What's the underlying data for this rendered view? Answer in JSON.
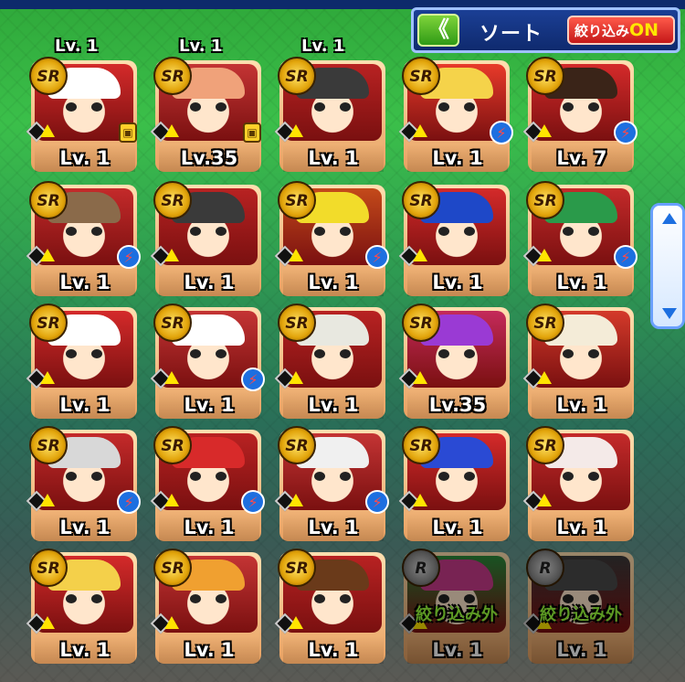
{
  "toolbar": {
    "back_icon": "double-chevron-left-icon",
    "back_label": "《",
    "sort_label": "ソート",
    "filter_label": "絞り込み",
    "filter_state": "ON"
  },
  "partial_row": [
    "Lv. 1",
    "Lv. 1",
    "Lv. 1"
  ],
  "cards": [
    {
      "rarity": "SR",
      "level": "Lv. 1",
      "badge": "lock",
      "hair": "#ffffff",
      "bg": "#d42a2a"
    },
    {
      "rarity": "SR",
      "level": "Lv.35",
      "badge": "lock",
      "hair": "#f0a27a",
      "bg": "#c43434"
    },
    {
      "rarity": "SR",
      "level": "Lv. 1",
      "badge": "none",
      "hair": "#3a3a3a",
      "bg": "#b82222"
    },
    {
      "rarity": "SR",
      "level": "Lv. 1",
      "badge": "bolt",
      "hair": "#f5d34a",
      "bg": "#e83a2a"
    },
    {
      "rarity": "SR",
      "level": "Lv. 7",
      "badge": "bolt",
      "hair": "#3a2418",
      "bg": "#d42a2a"
    },
    {
      "rarity": "SR",
      "level": "Lv. 1",
      "badge": "bolt",
      "hair": "#8a6a4a",
      "bg": "#c42a2a"
    },
    {
      "rarity": "SR",
      "level": "Lv. 1",
      "badge": "none",
      "hair": "#3a3a3a",
      "bg": "#b82222"
    },
    {
      "rarity": "SR",
      "level": "Lv. 1",
      "badge": "bolt",
      "hair": "#f2dc2a",
      "bg": "#c44a1a"
    },
    {
      "rarity": "SR",
      "level": "Lv. 1",
      "badge": "none",
      "hair": "#1e48c8",
      "bg": "#d42a2a"
    },
    {
      "rarity": "SR",
      "level": "Lv. 1",
      "badge": "bolt",
      "hair": "#2a9a4a",
      "bg": "#c42a2a"
    },
    {
      "rarity": "SR",
      "level": "Lv. 1",
      "badge": "none",
      "hair": "#ffffff",
      "bg": "#d42a2a"
    },
    {
      "rarity": "SR",
      "level": "Lv. 1",
      "badge": "bolt",
      "hair": "#ffffff",
      "bg": "#c43434"
    },
    {
      "rarity": "SR",
      "level": "Lv. 1",
      "badge": "none",
      "hair": "#e8e8e0",
      "bg": "#b82222"
    },
    {
      "rarity": "SR",
      "level": "Lv.35",
      "badge": "none",
      "hair": "#9a3ad4",
      "bg": "#c42a5a"
    },
    {
      "rarity": "SR",
      "level": "Lv. 1",
      "badge": "none",
      "hair": "#f4ecd8",
      "bg": "#d43a2a"
    },
    {
      "rarity": "SR",
      "level": "Lv. 1",
      "badge": "bolt",
      "hair": "#d8d8d8",
      "bg": "#c42a2a"
    },
    {
      "rarity": "SR",
      "level": "Lv. 1",
      "badge": "bolt",
      "hair": "#d82a2a",
      "bg": "#b82222"
    },
    {
      "rarity": "SR",
      "level": "Lv. 1",
      "badge": "bolt",
      "hair": "#f0f0f0",
      "bg": "#c43434"
    },
    {
      "rarity": "SR",
      "level": "Lv. 1",
      "badge": "none",
      "hair": "#2a4ad4",
      "bg": "#d42a2a"
    },
    {
      "rarity": "SR",
      "level": "Lv. 1",
      "badge": "none",
      "hair": "#f4eae8",
      "bg": "#c42a2a"
    },
    {
      "rarity": "SR",
      "level": "Lv. 1",
      "badge": "none",
      "hair": "#f4d04a",
      "bg": "#d42a2a"
    },
    {
      "rarity": "SR",
      "level": "Lv. 1",
      "badge": "none",
      "hair": "#f0a030",
      "bg": "#c43434"
    },
    {
      "rarity": "SR",
      "level": "Lv. 1",
      "badge": "none",
      "hair": "#6a3a1a",
      "bg": "#b82222"
    },
    {
      "rarity": "R",
      "level": "Lv. 1",
      "badge": "none",
      "hair": "#c83a8a",
      "bg": "#2a8a3a",
      "excluded": "絞り込み外"
    },
    {
      "rarity": "R",
      "level": "Lv. 1",
      "badge": "none",
      "hair": "#4a4a4a",
      "bg": "#3a3a3a",
      "excluded": "絞り込み外"
    }
  ]
}
